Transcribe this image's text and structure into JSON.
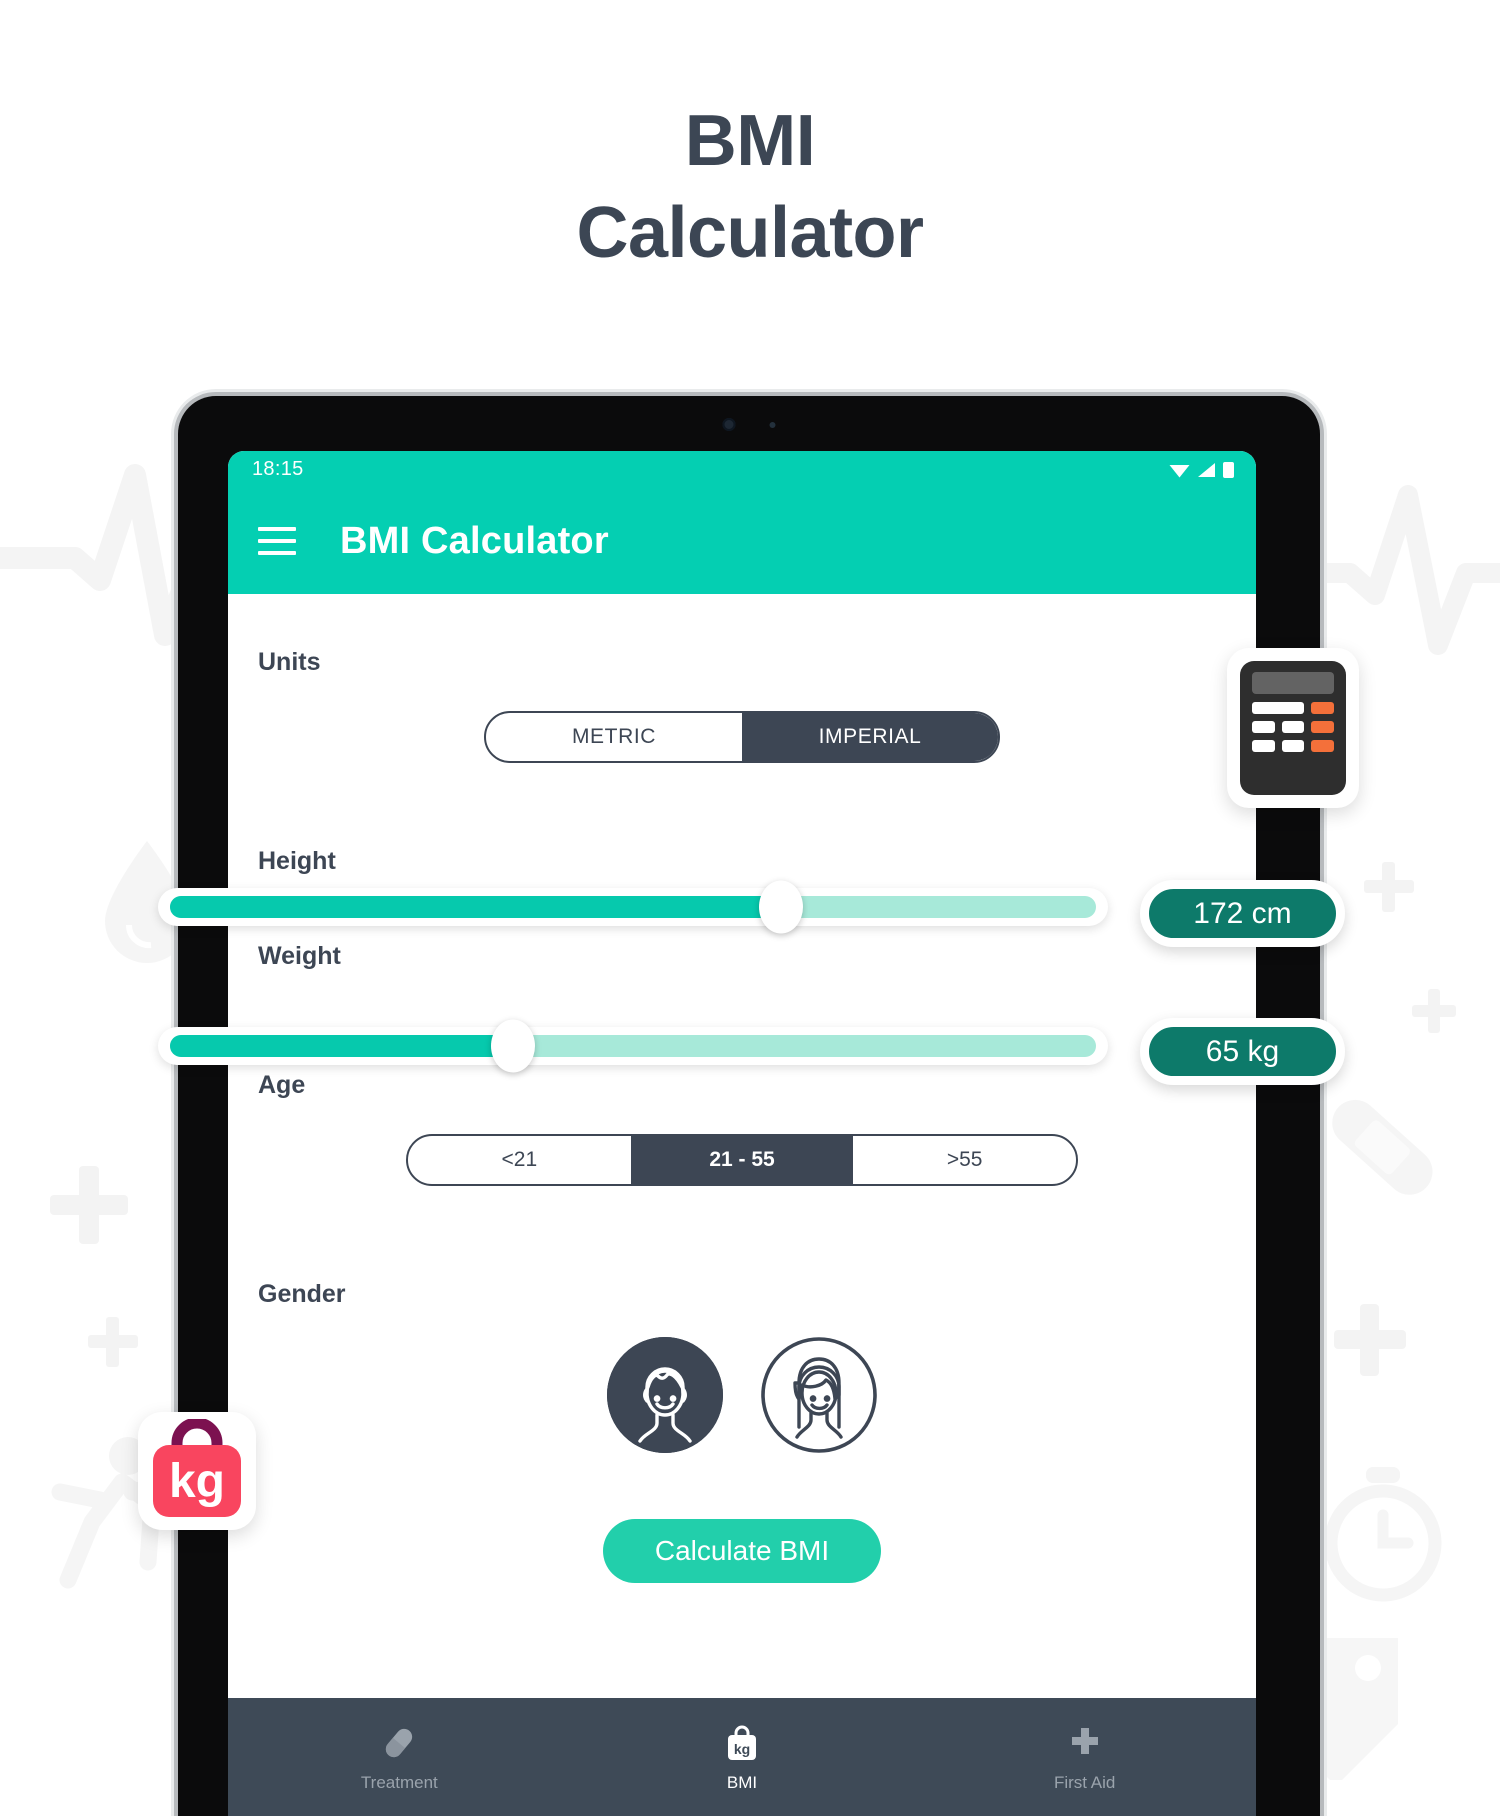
{
  "hero": {
    "title_line1": "BMI",
    "title_line2": "Calculator",
    "title_color": "#3c4654"
  },
  "status_bar": {
    "time": "18:15",
    "icons": [
      "wifi-icon",
      "signal-icon",
      "battery-icon"
    ]
  },
  "app_bar": {
    "menu_icon": "hamburger-menu-icon",
    "title": "BMI Calculator",
    "background": "#04cfb2"
  },
  "units": {
    "label": "Units",
    "options": [
      {
        "label": "METRIC",
        "selected": false
      },
      {
        "label": "IMPERIAL",
        "selected": true
      }
    ]
  },
  "height": {
    "label": "Height",
    "value_text": "172 cm",
    "value": 172,
    "unit": "cm",
    "slider_percent": 66
  },
  "weight": {
    "label": "Weight",
    "value_text": "65 kg",
    "value": 65,
    "unit": "kg",
    "slider_percent": 37
  },
  "age": {
    "label": "Age",
    "options": [
      {
        "label": "<21",
        "selected": false
      },
      {
        "label": "21 - 55",
        "selected": true
      },
      {
        "label": ">55",
        "selected": false
      }
    ]
  },
  "gender": {
    "label": "Gender",
    "options": [
      {
        "icon": "male-avatar-icon",
        "selected": true
      },
      {
        "icon": "female-avatar-icon",
        "selected": false
      }
    ]
  },
  "actions": {
    "calculate_label": "Calculate BMI"
  },
  "bottom_nav": {
    "items": [
      {
        "label": "Treatment",
        "icon": "pill-icon",
        "active": false
      },
      {
        "label": "BMI",
        "icon": "kg-bag-icon",
        "active": true
      },
      {
        "label": "First Aid",
        "icon": "plus-cross-icon",
        "active": false
      }
    ]
  },
  "stickers": {
    "calculator": {
      "name": "calculator-sticker"
    },
    "kg_bag": {
      "name": "kg-bag-sticker",
      "text": "kg"
    }
  },
  "colors": {
    "teal": "#04cfb2",
    "teal_fill": "#06c9ad",
    "teal_track": "#a7e9d9",
    "badge_green": "#0d7a6a",
    "slate": "#3d4654",
    "nav_bar": "#3e4a57",
    "accent_pink": "#f9455f",
    "accent_orange": "#f4703a"
  }
}
